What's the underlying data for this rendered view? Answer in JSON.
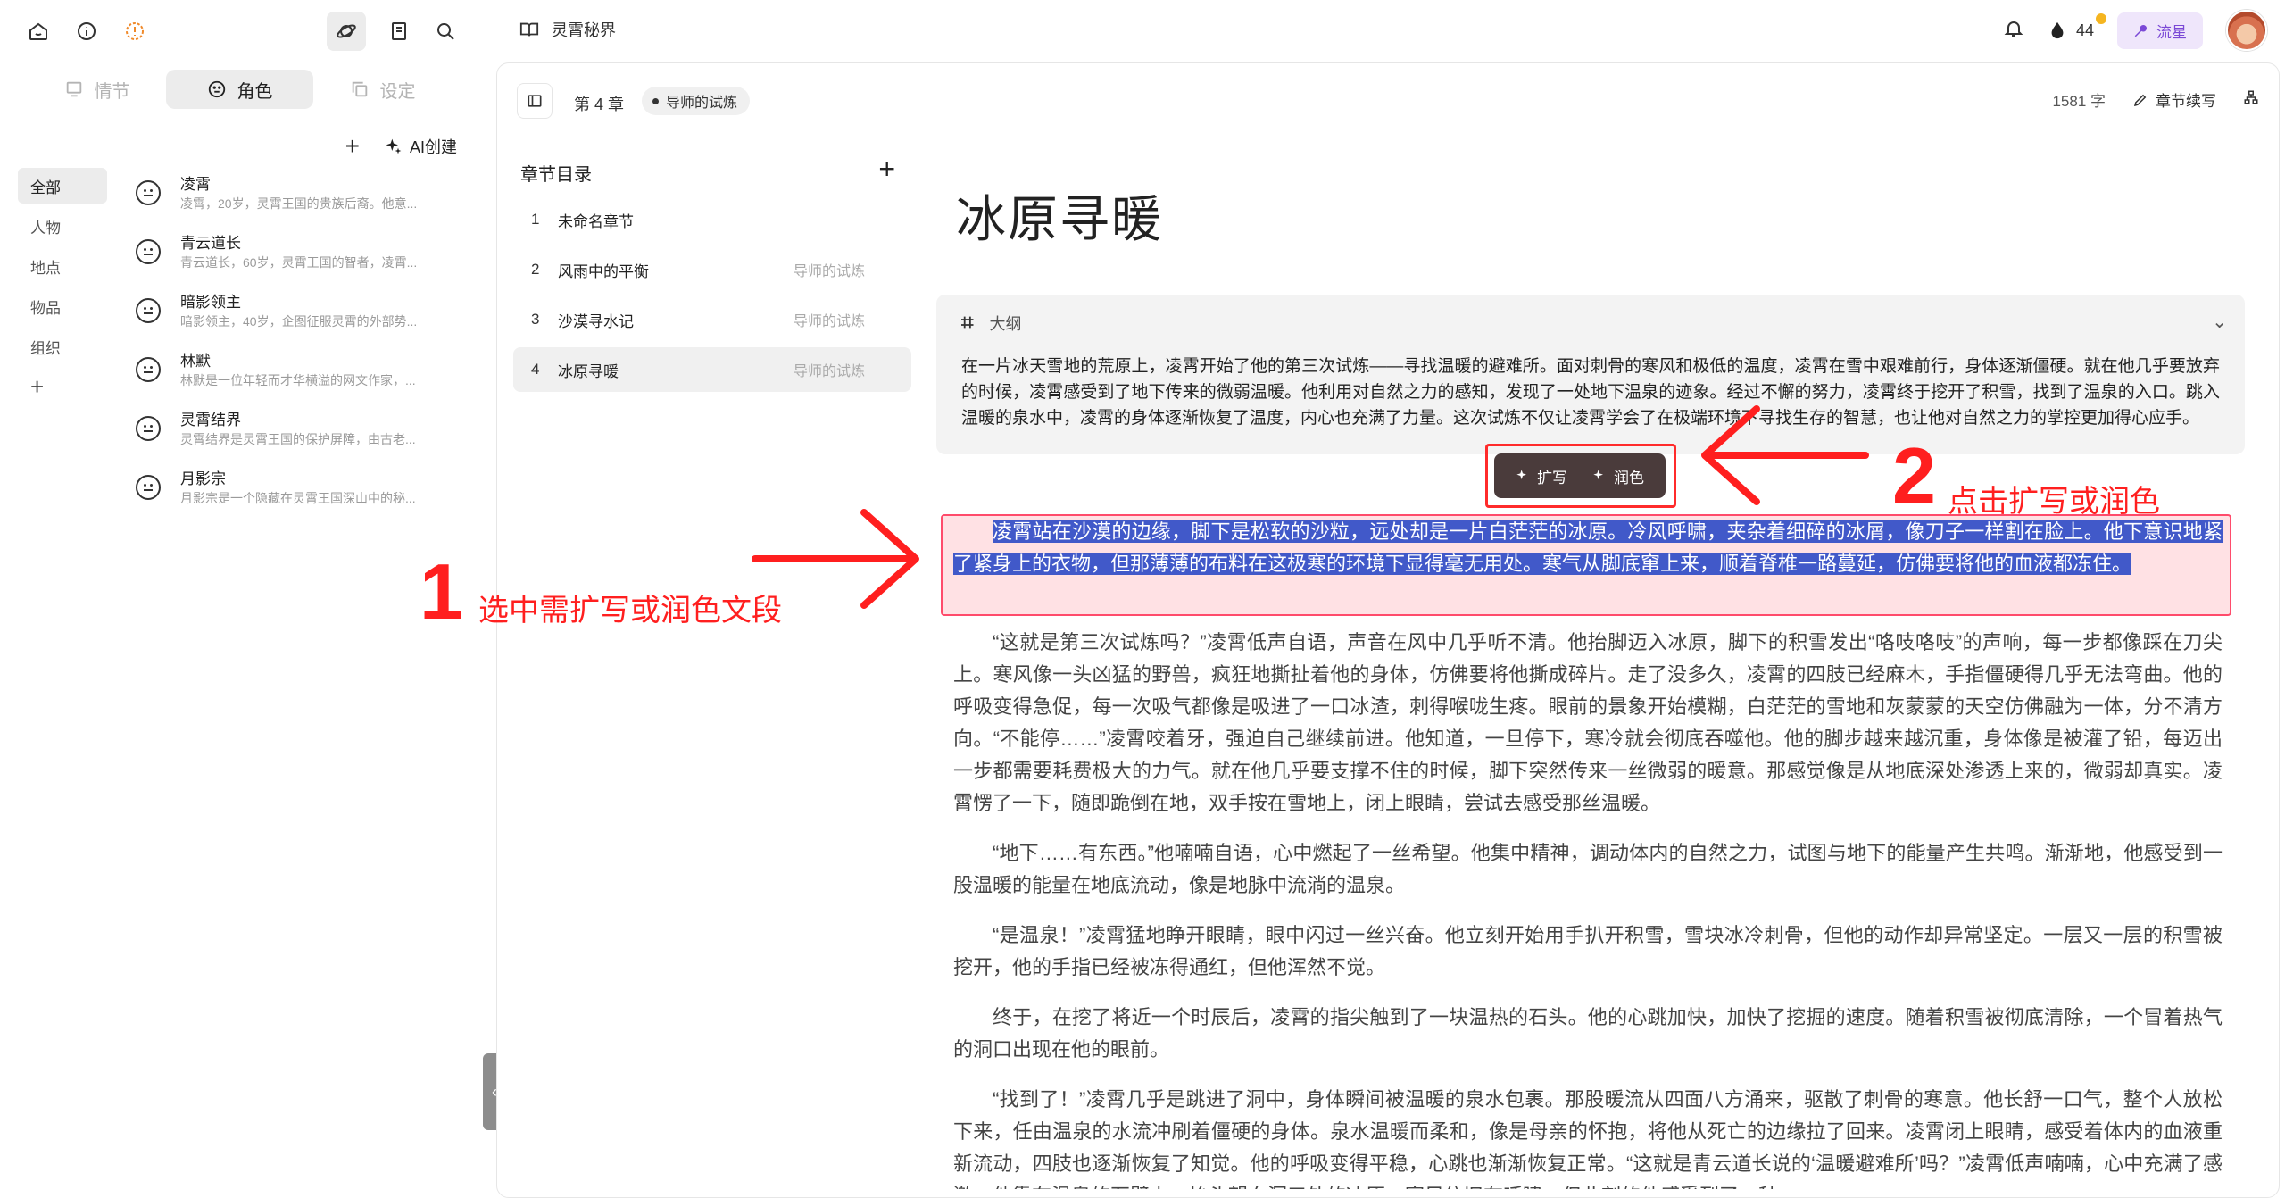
{
  "left": {
    "tabs": [
      {
        "label": "情节",
        "active": false
      },
      {
        "label": "角色",
        "active": true
      },
      {
        "label": "设定",
        "active": false
      }
    ],
    "ai_create_label": "AI创建",
    "categories": [
      "全部",
      "人物",
      "地点",
      "物品",
      "组织"
    ],
    "characters": [
      {
        "name": "凌霄",
        "desc": "凌霄，20岁，灵霄王国的贵族后裔。他意..."
      },
      {
        "name": "青云道长",
        "desc": "青云道长，60岁，灵霄王国的智者，凌霄..."
      },
      {
        "name": "暗影领主",
        "desc": "暗影领主，40岁，企图征服灵霄的外部势..."
      },
      {
        "name": "林默",
        "desc": "林默是一位年轻而才华横溢的网文作家，..."
      },
      {
        "name": "灵霄结界",
        "desc": "灵霄结界是灵霄王国的保护屏障，由古老..."
      },
      {
        "name": "月影宗",
        "desc": "月影宗是一个隐藏在灵霄王国深山中的秘..."
      }
    ]
  },
  "topbar": {
    "project_name": "灵霄秘界",
    "points": "44",
    "plan_label": "流星"
  },
  "editor": {
    "chapter_label": "第 4 章",
    "chapter_tag": "导师的试炼",
    "word_count": "1581 字",
    "continue_label": "章节续写",
    "toc_title": "章节目录",
    "toc": [
      {
        "num": "1",
        "title": "未命名章节",
        "sub": ""
      },
      {
        "num": "2",
        "title": "风雨中的平衡",
        "sub": "导师的试炼"
      },
      {
        "num": "3",
        "title": "沙漠寻水记",
        "sub": "导师的试炼"
      },
      {
        "num": "4",
        "title": "冰原寻暖",
        "sub": "导师的试炼"
      }
    ],
    "title": "冰原寻暖",
    "outline_label": "大纲",
    "outline_text": "在一片冰天雪地的荒原上，凌霄开始了他的第三次试炼——寻找温暖的避难所。面对刺骨的寒风和极低的温度，凌霄在雪中艰难前行，身体逐渐僵硬。就在他几乎要放弃的时候，凌霄感受到了地下传来的微弱温暖。他利用对自然之力的感知，发现了一处地下温泉的迹象。经过不懈的努力，凌霄终于挖开了积雪，找到了温泉的入口。跳入温暖的泉水中，凌霄的身体逐渐恢复了温度，内心也充满了力量。这次试炼不仅让凌霄学会了在极端环境下寻找生存的智慧，也让他对自然之力的掌控更加得心应手。",
    "popup": {
      "expand": "扩写",
      "polish": "润色"
    },
    "paragraphs": [
      "凌霄站在沙漠的边缘，脚下是松软的沙粒，远处却是一片白茫茫的冰原。冷风呼啸，夹杂着细碎的冰屑，像刀子一样割在脸上。他下意识地紧了紧身上的衣物，但那薄薄的布料在这极寒的环境下显得毫无用处。寒气从脚底窜上来，顺着脊椎一路蔓延，仿佛要将他的血液都冻住。",
      "“这就是第三次试炼吗？”凌霄低声自语，声音在风中几乎听不清。他抬脚迈入冰原，脚下的积雪发出“咯吱咯吱”的声响，每一步都像踩在刀尖上。寒风像一头凶猛的野兽，疯狂地撕扯着他的身体，仿佛要将他撕成碎片。走了没多久，凌霄的四肢已经麻木，手指僵硬得几乎无法弯曲。他的呼吸变得急促，每一次吸气都像是吸进了一口冰渣，刺得喉咙生疼。眼前的景象开始模糊，白茫茫的雪地和灰蒙蒙的天空仿佛融为一体，分不清方向。“不能停……”凌霄咬着牙，强迫自己继续前进。他知道，一旦停下，寒冷就会彻底吞噬他。他的脚步越来越沉重，身体像是被灌了铅，每迈出一步都需要耗费极大的力气。就在他几乎要支撑不住的时候，脚下突然传来一丝微弱的暖意。那感觉像是从地底深处渗透上来的，微弱却真实。凌霄愣了一下，随即跪倒在地，双手按在雪地上，闭上眼睛，尝试去感受那丝温暖。",
      "“地下……有东西。”他喃喃自语，心中燃起了一丝希望。他集中精神，调动体内的自然之力，试图与地下的能量产生共鸣。渐渐地，他感受到一股温暖的能量在地底流动，像是地脉中流淌的温泉。",
      "“是温泉！”凌霄猛地睁开眼睛，眼中闪过一丝兴奋。他立刻开始用手扒开积雪，雪块冰冷刺骨，但他的动作却异常坚定。一层又一层的积雪被挖开，他的手指已经被冻得通红，但他浑然不觉。",
      "终于，在挖了将近一个时辰后，凌霄的指尖触到了一块温热的石头。他的心跳加快，加快了挖掘的速度。随着积雪被彻底清除，一个冒着热气的洞口出现在他的眼前。",
      "“找到了！”凌霄几乎是跳进了洞中，身体瞬间被温暖的泉水包裹。那股暖流从四面八方涌来，驱散了刺骨的寒意。他长舒一口气，整个人放松下来，任由温泉的水流冲刷着僵硬的身体。泉水温暖而柔和，像是母亲的怀抱，将他从死亡的边缘拉了回来。凌霄闭上眼睛，感受着体内的血液重新流动，四肢也逐渐恢复了知觉。他的呼吸变得平稳，心跳也渐渐恢复正常。“这就是青云道长说的‘温暖避难所’吗？”凌霄低声喃喃，心中充满了感激。他靠在温泉的石壁上，抬头望向洞口外的冰原，寒风依旧在呼啸，但此刻的他感受到了一种"
    ]
  },
  "annotations": {
    "step1_num": "1",
    "step1_text": "选中需扩写或润色文段",
    "step2_num": "2",
    "step2_text": "点击扩写或润色"
  },
  "colors": {
    "annotation_red": "#ff1f1f",
    "selection_blue": "#4159c9",
    "plan_purple": "#7b49d6"
  }
}
